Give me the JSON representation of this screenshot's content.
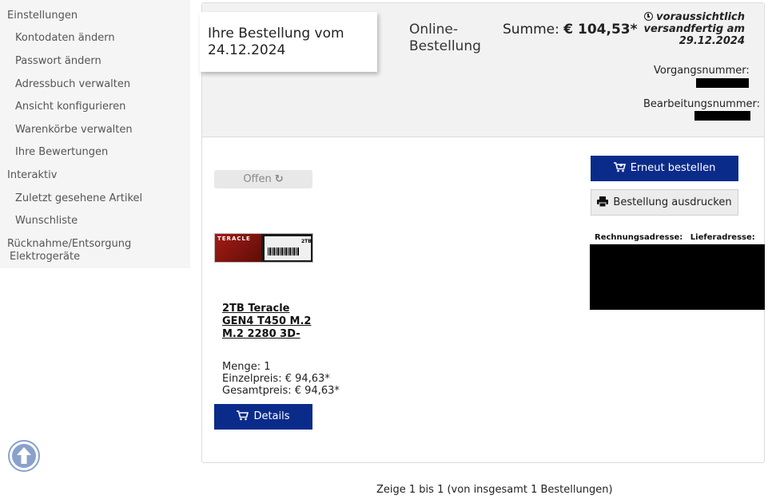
{
  "sidebar": {
    "groups": [
      {
        "label": "Einstellungen"
      },
      {
        "label": "Interaktiv"
      },
      {
        "label": "Rücknahme/Entsorgung"
      }
    ],
    "einstellungen_items": [
      {
        "label": "Kontodaten ändern"
      },
      {
        "label": "Passwort ändern"
      },
      {
        "label": "Adressbuch verwalten"
      },
      {
        "label": "Ansicht konfigurieren"
      },
      {
        "label": "Warenkörbe verwalten"
      },
      {
        "label": "Ihre Bewertungen"
      }
    ],
    "interaktiv_items": [
      {
        "label": "Zuletzt gesehene Artikel"
      },
      {
        "label": "Wunschliste"
      }
    ],
    "ruecknahme_second_line": "Elektrogeräte"
  },
  "order": {
    "title_line1": "Ihre Bestellung vom",
    "date": "24.12.2024",
    "type_line1": "Online-",
    "type_line2": "Bestellung",
    "sum_label": "Summe:",
    "sum_value": "€ 104,53*",
    "shipping_line1": "voraussichtlich",
    "shipping_line2": "versandfertig am",
    "shipping_date": "29.12.2024",
    "vorgang_label": "Vorgangsnummer:",
    "bearbeitung_label": "Bearbeitungsnummer:",
    "status": "Offen",
    "icons": {
      "status": "refresh-icon",
      "shipping": "clock-icon",
      "reorder": "cart-icon",
      "print": "printer-icon",
      "details": "cart-icon"
    }
  },
  "product": {
    "name_lines": [
      "2TB Teracle",
      "GEN4 T450 M.2",
      "M.2 2280 3D-"
    ],
    "image_brand": "TERACLE",
    "image_capacity": "2TB",
    "quantity": "Menge: 1",
    "unit_price": "Einzelpreis: € 94,63*",
    "total_price": "Gesamtpreis: € 94,63*",
    "details_label": "Details"
  },
  "actions": {
    "reorder_label": "Erneut bestellen",
    "print_label": "Bestellung ausdrucken"
  },
  "addresses": {
    "billing_label": "Rechnungsadresse:",
    "delivery_label": "Lieferadresse:"
  },
  "pager": {
    "text": "Zeige 1 bis 1 (von insgesamt 1 Bestellungen)"
  },
  "colors": {
    "primary": "#0b2b8a",
    "sidebar_bg": "#f5f5f5",
    "header_bg": "#f2f2f2",
    "scroll_top": "#8aa1cc"
  }
}
